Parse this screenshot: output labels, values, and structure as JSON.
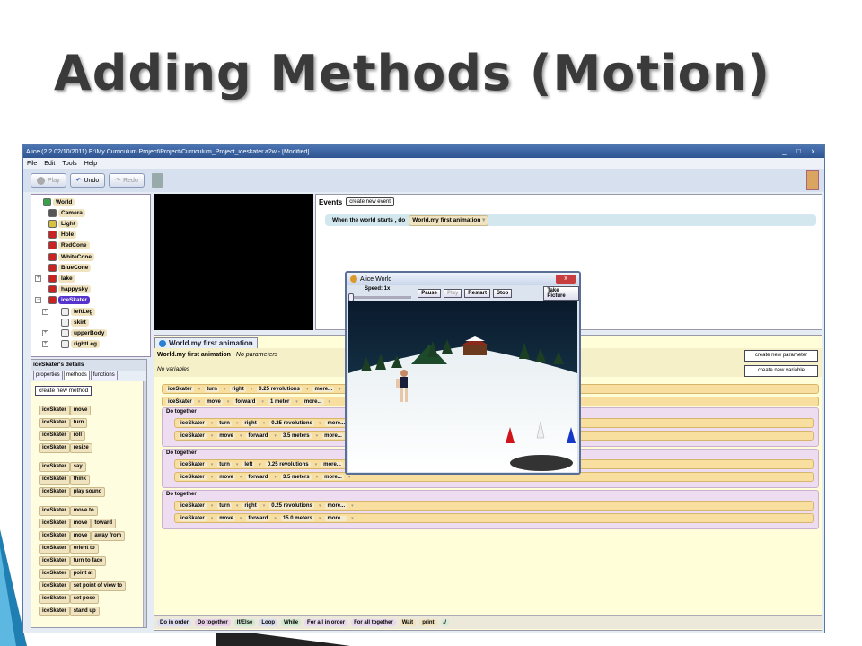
{
  "slide": {
    "title": "Adding Methods (Motion)"
  },
  "window": {
    "title": "Alice (2.2  02/10/2011) E:\\My Curriculum Project\\Project\\Curriculum_Project_iceskater.a2w - [Modified]",
    "controls": [
      "_",
      "□",
      "x"
    ]
  },
  "menu": [
    "File",
    "Edit",
    "Tools",
    "Help"
  ],
  "toolbar": {
    "play": "Play",
    "undo": "Undo",
    "redo": "Redo"
  },
  "object_tree": {
    "items": [
      {
        "label": "World",
        "icon": "world-icon",
        "color": "#3aa04a",
        "indent": 0
      },
      {
        "label": "Camera",
        "icon": "camera-icon",
        "color": "#555555",
        "indent": 1
      },
      {
        "label": "Light",
        "icon": "light-icon",
        "color": "#d8c040",
        "indent": 1
      },
      {
        "label": "Hole",
        "icon": "object-icon",
        "color": "#cc2222",
        "indent": 1
      },
      {
        "label": "RedCone",
        "icon": "object-icon",
        "color": "#cc2222",
        "indent": 1
      },
      {
        "label": "WhiteCone",
        "icon": "object-icon",
        "color": "#cc2222",
        "indent": 1
      },
      {
        "label": "BlueCone",
        "icon": "object-icon",
        "color": "#cc2222",
        "indent": 1
      },
      {
        "label": "lake",
        "icon": "object-icon",
        "color": "#cc2222",
        "indent": 1,
        "expander": "+"
      },
      {
        "label": "happysky",
        "icon": "object-icon",
        "color": "#cc2222",
        "indent": 1
      },
      {
        "label": "iceSkater",
        "icon": "object-icon",
        "color": "#cc2222",
        "indent": 1,
        "expander": "−",
        "selected": true
      },
      {
        "label": "leftLeg",
        "icon": "part-icon",
        "color": "#eeeeee",
        "indent": 2,
        "expander": "+"
      },
      {
        "label": "skirt",
        "icon": "part-icon",
        "color": "#eeeeee",
        "indent": 2
      },
      {
        "label": "upperBody",
        "icon": "part-icon",
        "color": "#eeeeee",
        "indent": 2,
        "expander": "+"
      },
      {
        "label": "rightLeg",
        "icon": "part-icon",
        "color": "#eeeeee",
        "indent": 2,
        "expander": "+"
      }
    ]
  },
  "events": {
    "title": "Events",
    "create_button": "create new event",
    "row_text": "When the world starts , do",
    "row_value": "World.my first animation"
  },
  "details": {
    "title": "iceSkater's details",
    "tabs": [
      "properties",
      "methods",
      "functions"
    ],
    "create_button": "create new method",
    "methods": [
      [
        "iceSkater",
        "move"
      ],
      [
        "iceSkater",
        "turn"
      ],
      [
        "iceSkater",
        "roll"
      ],
      [
        "iceSkater",
        "resize"
      ],
      [
        "iceSkater",
        "say"
      ],
      [
        "iceSkater",
        "think"
      ],
      [
        "iceSkater",
        "play sound"
      ],
      [
        "iceSkater",
        "move to"
      ],
      [
        "iceSkater",
        "move",
        "toward"
      ],
      [
        "iceSkater",
        "move",
        "away from"
      ],
      [
        "iceSkater",
        "orient to"
      ],
      [
        "iceSkater",
        "turn to face"
      ],
      [
        "iceSkater",
        "point at"
      ],
      [
        "iceSkater",
        "set point of view to"
      ],
      [
        "iceSkater",
        "set pose"
      ],
      [
        "iceSkater",
        "stand up"
      ]
    ]
  },
  "editor": {
    "tab": "World.my first animation",
    "header_name": "World.my first animation",
    "header_params": "No parameters",
    "no_variables": "No variables",
    "create_parameter": "create new parameter",
    "create_variable": "create new variable",
    "do_together": "Do together",
    "top_statements": [
      {
        "obj": "iceSkater",
        "verb": "turn",
        "dir": "right",
        "amount": "0.25 revolutions",
        "more": "more..."
      },
      {
        "obj": "iceSkater",
        "verb": "move",
        "dir": "forward",
        "amount": "1 meter",
        "more": "more..."
      }
    ],
    "groups": [
      {
        "statements": [
          {
            "obj": "iceSkater",
            "verb": "turn",
            "dir": "right",
            "amount": "0.25 revolutions",
            "more": "more..."
          },
          {
            "obj": "iceSkater",
            "verb": "move",
            "dir": "forward",
            "amount": "3.5 meters",
            "more": "more..."
          }
        ]
      },
      {
        "statements": [
          {
            "obj": "iceSkater",
            "verb": "turn",
            "dir": "left",
            "amount": "0.25 revolutions",
            "more": "more..."
          },
          {
            "obj": "iceSkater",
            "verb": "move",
            "dir": "forward",
            "amount": "3.5 meters",
            "more": "more..."
          }
        ]
      },
      {
        "statements": [
          {
            "obj": "iceSkater",
            "verb": "turn",
            "dir": "right",
            "amount": "0.25 revolutions",
            "more": "more..."
          },
          {
            "obj": "iceSkater",
            "verb": "move",
            "dir": "forward",
            "amount": "15.0 meters",
            "more": "more..."
          }
        ]
      }
    ],
    "bottom_buttons": [
      {
        "label": "Do in order",
        "color": "#ddddf2"
      },
      {
        "label": "Do together",
        "color": "#e8cfe8"
      },
      {
        "label": "If/Else",
        "color": "#cfe6cf"
      },
      {
        "label": "Loop",
        "color": "#d7dcee"
      },
      {
        "label": "While",
        "color": "#cfe8d0"
      },
      {
        "label": "For all in order",
        "color": "#e8d8ee"
      },
      {
        "label": "For all together",
        "color": "#e8d8ee"
      },
      {
        "label": "Wait",
        "color": "#f0e3c0"
      },
      {
        "label": "print",
        "color": "#f0e3c0"
      },
      {
        "label": "//",
        "color": "#d8ead8"
      }
    ]
  },
  "alice_world": {
    "title": "Alice World",
    "close": "x",
    "speed": "Speed: 1x",
    "pause": "Pause",
    "play": "Play",
    "restart": "Restart",
    "stop": "Stop",
    "take_picture": "Take Picture"
  }
}
